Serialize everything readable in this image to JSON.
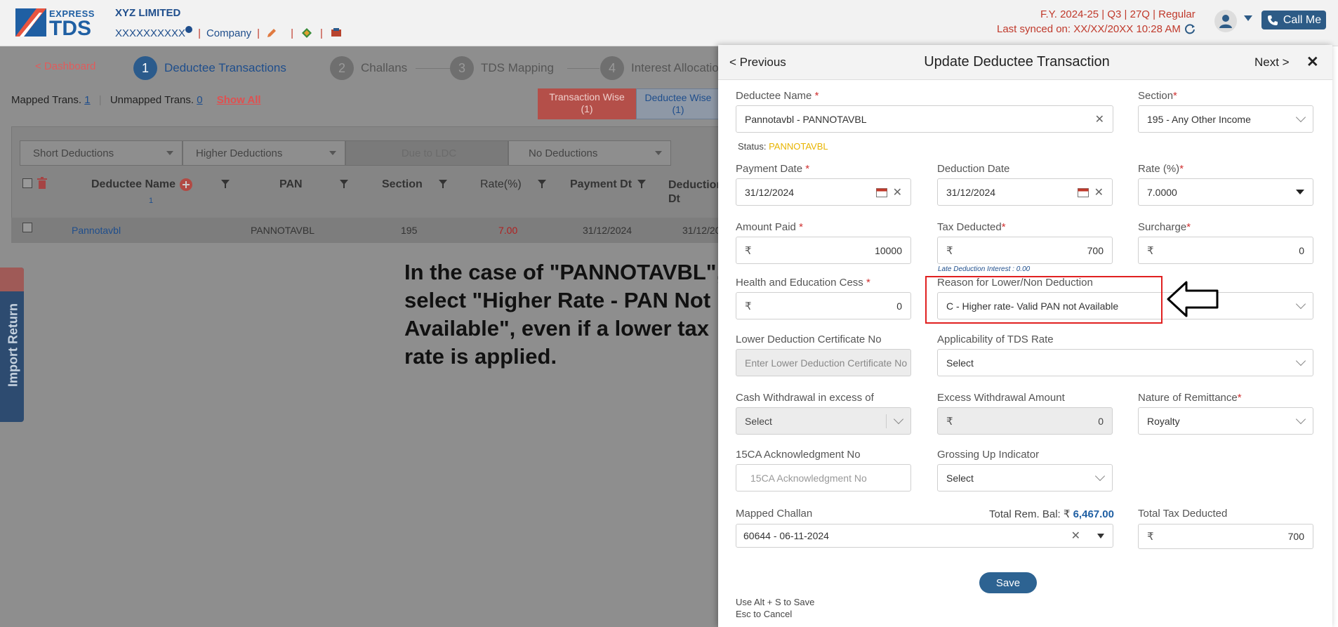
{
  "header": {
    "logo_express": "EXPRESS",
    "logo_tds": "TDS",
    "company_name": "XYZ LIMITED",
    "company_id": "XXXXXXXXXX",
    "company_link": "Company",
    "fy_info": "F.Y. 2024-25  | Q3  | 27Q | Regular",
    "last_synced": "Last synced on: XX/XX/20XX 10:28 AM",
    "call_me": "Call Me"
  },
  "nav": {
    "dashboard": "< Dashboard",
    "steps": [
      {
        "num": "1",
        "label": "Deductee Transactions"
      },
      {
        "num": "2",
        "label": "Challans"
      },
      {
        "num": "3",
        "label": "TDS Mapping"
      },
      {
        "num": "4",
        "label": "Interest Allocation"
      }
    ]
  },
  "summary": {
    "mapped_label": "Mapped Trans.",
    "mapped_count": "1",
    "unmapped_label": "Unmapped Trans.",
    "unmapped_count": "0",
    "show_all": "Show All",
    "transaction_wise": "Transaction Wise",
    "transaction_wise_count": "(1)",
    "deductee_wise": "Deductee Wise",
    "deductee_wise_count": "(1)"
  },
  "filters": [
    "Short Deductions",
    "Higher Deductions",
    "Due to LDC",
    "No Deductions"
  ],
  "table": {
    "headers": [
      "Deductee Name",
      "PAN",
      "Section",
      "Rate(%)",
      "Payment Dt",
      "Deduction Dt"
    ],
    "name_count": "1",
    "row": {
      "name": "Pannotavbl",
      "pan": "PANNOTAVBL",
      "section": "195",
      "rate": "7.00",
      "payment_dt": "31/12/2024",
      "deduction_dt": "31/12/20"
    }
  },
  "instruction": "In the case of \"PANNOTAVBL\", select \"Higher Rate - PAN Not Available\", even if a lower tax rate is applied.",
  "import_return": "Import Return",
  "modal": {
    "prev": "< Previous",
    "title": "Update Deductee Transaction",
    "next": "Next >",
    "close": "✕",
    "deductee_name_label": "Deductee Name",
    "deductee_name_value": "Pannotavbl - PANNOTAVBL",
    "status_label": "Status:",
    "status_value": "PANNOTAVBL",
    "section_label": "Section",
    "section_value": "195 - Any Other Income",
    "payment_date_label": "Payment Date",
    "payment_date_value": "31/12/2024",
    "deduction_date_label": "Deduction Date",
    "deduction_date_value": "31/12/2024",
    "rate_label": "Rate (%)",
    "rate_value": "7.0000",
    "amount_paid_label": "Amount Paid",
    "amount_paid_value": "10000",
    "tax_deducted_label": "Tax Deducted",
    "tax_deducted_value": "700",
    "late_interest": "Late Deduction Interest : 0.00",
    "surcharge_label": "Surcharge",
    "surcharge_value": "0",
    "cess_label": "Health and Education Cess",
    "cess_value": "0",
    "reason_label": "Reason for Lower/Non Deduction",
    "reason_value": "C - Higher rate- Valid PAN not Available",
    "ldc_label": "Lower Deduction Certificate No",
    "ldc_placeholder": "Enter Lower Deduction Certificate No",
    "applicability_label": "Applicability of TDS Rate",
    "applicability_value": "Select",
    "cash_withdrawal_label": "Cash Withdrawal in excess of",
    "cash_withdrawal_value": "Select",
    "excess_withdrawal_label": "Excess Withdrawal Amount",
    "excess_withdrawal_value": "0",
    "nature_label": "Nature of Remittance",
    "nature_value": "Royalty",
    "ack_label": "15CA Acknowledgment No",
    "ack_placeholder": "15CA Acknowledgment No",
    "grossing_label": "Grossing Up Indicator",
    "grossing_value": "Select",
    "mapped_challan_label": "Mapped Challan",
    "total_rem_label": "Total Rem. Bal: ₹",
    "total_rem_value": "6,467.00",
    "mapped_challan_value": "60644 - 06-11-2024",
    "total_tax_label": "Total Tax Deducted",
    "total_tax_value": "700",
    "save": "Save",
    "hint_save": "Use Alt + S to Save",
    "hint_cancel": "Esc to Cancel",
    "rupee": "₹",
    "required_mark": "*"
  },
  "colors": {
    "brand": "#1f5fa3",
    "accent_red": "#c0392b",
    "save_blue": "#2d6392",
    "highlight_box": "#e02020"
  }
}
